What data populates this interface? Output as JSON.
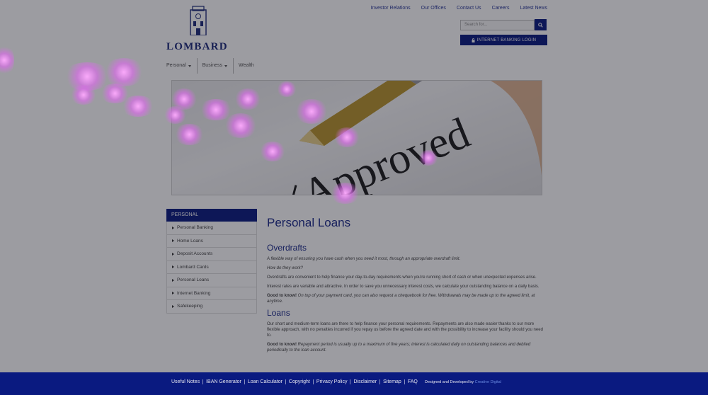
{
  "brand": {
    "name": "LOMBARD"
  },
  "topnav": {
    "items": [
      "Investor Relations",
      "Our Offices",
      "Contact Us",
      "Careers",
      "Latest News"
    ]
  },
  "search": {
    "placeholder": "Search for..."
  },
  "ib_button": {
    "label": "INTERNET BANKING LOGIN"
  },
  "mainnav": {
    "items": [
      {
        "label": "Personal",
        "has_menu": true
      },
      {
        "label": "Business",
        "has_menu": true
      },
      {
        "label": "Wealth",
        "has_menu": false
      }
    ]
  },
  "hero": {
    "text": "Approved"
  },
  "sidebar": {
    "heading": "PERSONAL",
    "items": [
      "Personal Banking",
      "Home Loans",
      "Deposit Accounts",
      "Lombard Cards",
      "Personal Loans",
      "Internet Banking",
      "Safekeeping"
    ]
  },
  "content": {
    "title": "Personal Loans",
    "overdrafts": {
      "heading": "Overdrafts",
      "lead": "A flexible way of ensuring you have cash when you need it most, through an appropriate overdraft limit.",
      "question": "How do they work?",
      "p1": "Overdrafts are convenient to help finance your day-to-day requirements when you're running short of cash or when unexpected expenses arise.",
      "p2": "Interest rates are variable and attractive.  In order to save you unnecessary interest costs, we calculate your outstanding balance on a daily basis.",
      "note_label": "Good to know!",
      "note": "On top of your payment card, you can also request a chequebook for free.  Withdrawals may be made up to the agreed limit, at anytime."
    },
    "loans": {
      "heading": "Loans",
      "p1": "Our short and medium-term loans are there to help finance your personal requirements.  Repayments are also made easier thanks to our more flexible approach, with no penalties incurred if you repay us before the agreed date and with the possibility to increase your facility should you need to.",
      "note_label": "Good to know!",
      "note": "Repayment period is usually up to a maximum of five years; interest is calculated daily on outstanding balances and debited periodically to the loan account."
    }
  },
  "footer": {
    "links": [
      "Useful Notes",
      "IBAN Generator",
      "Loan Calculator",
      "Copyright",
      "Privacy Policy",
      "Disclaimer",
      "Sitemap",
      "FAQ"
    ],
    "credit_prefix": "Designed and Developed by",
    "credit_company": "Creative Digital"
  },
  "colors": {
    "brand_navy": "#0a1a80",
    "link": "#2b3a9a",
    "heading": "#1a2a8a"
  }
}
